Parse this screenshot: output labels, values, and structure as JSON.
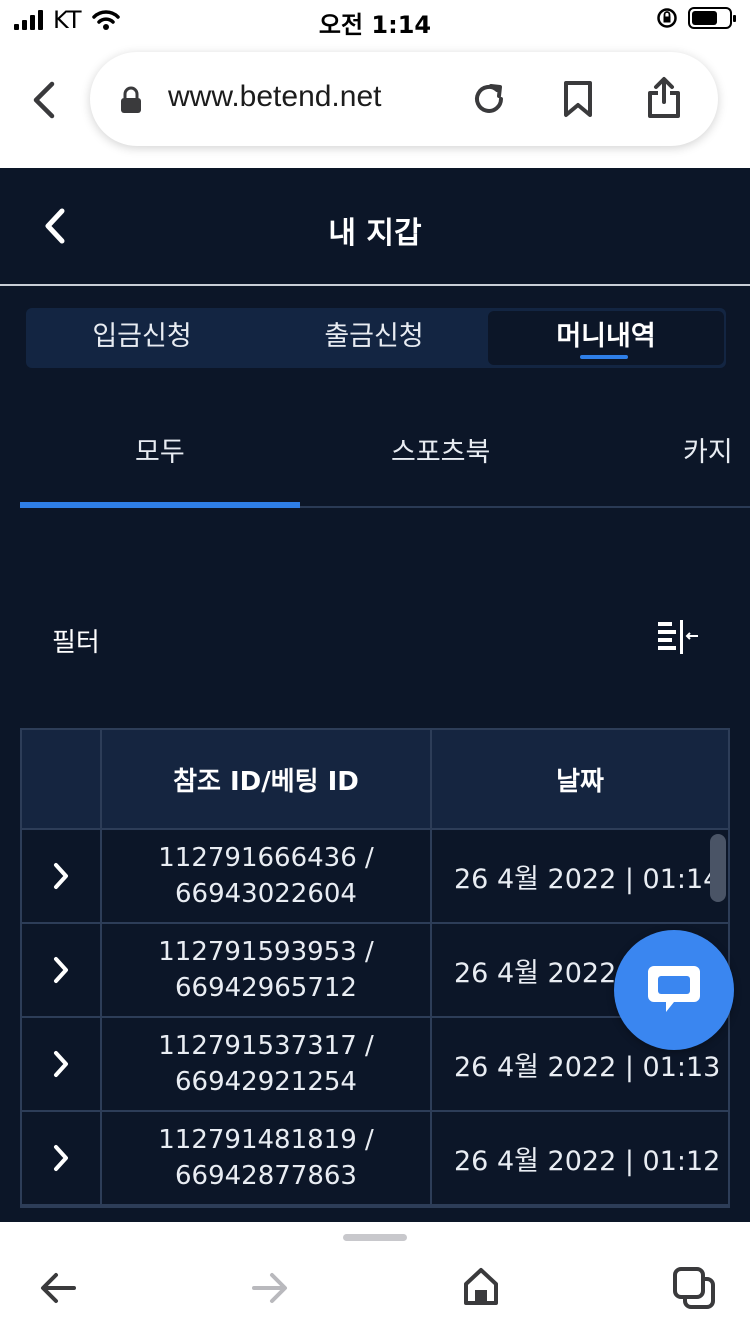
{
  "status_bar": {
    "carrier": "KT",
    "time": "오전 1:14"
  },
  "browser": {
    "url": "www.betend.net"
  },
  "app": {
    "header_title": "내 지갑",
    "segments": [
      "입금신청",
      "출금신청",
      "머니내역"
    ],
    "active_segment": "머니내역",
    "subtabs": [
      "모두",
      "스포츠북",
      "카지"
    ],
    "active_subtab": "모두",
    "filter_label": "필터"
  },
  "table": {
    "headers": [
      "",
      "참조 ID/베팅 ID",
      "날짜"
    ],
    "rows": [
      {
        "ref_id": "112791666436 /",
        "bet_id": "66943022604",
        "date": "26 4월 2022 | 01:14"
      },
      {
        "ref_id": "112791593953 /",
        "bet_id": "66942965712",
        "date": "26 4월 2022 | 01:14"
      },
      {
        "ref_id": "112791537317 /",
        "bet_id": "66942921254",
        "date": "26 4월 2022 | 01:13"
      },
      {
        "ref_id": "112791481819 /",
        "bet_id": "66942877863",
        "date": "26 4월 2022 | 01:12"
      }
    ]
  },
  "colors": {
    "app_bg": "#0c1628",
    "accent": "#2f7fe8",
    "chat_fab": "#3a86f0"
  }
}
